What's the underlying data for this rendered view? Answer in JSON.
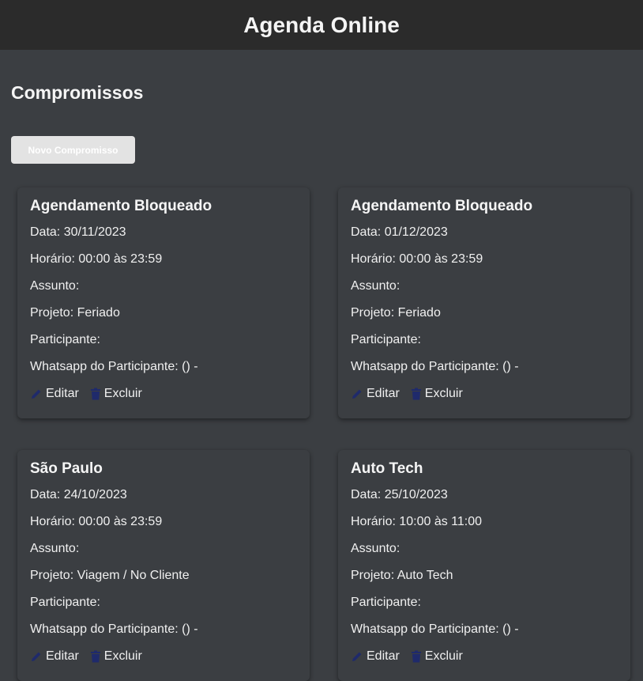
{
  "header": {
    "title": "Agenda Online"
  },
  "section": {
    "title": "Compromissos"
  },
  "toolbar": {
    "new_label": "Novo Compromisso"
  },
  "colors": {
    "icon": "#1f2a6b",
    "background": "#3b3e42",
    "topbar": "#2b2b2b"
  },
  "cards": [
    {
      "title": "Agendamento Bloqueado",
      "date": "Data: 30/11/2023",
      "time": "Horário: 00:00 às 23:59",
      "subject": "Assunto:",
      "project": "Projeto: Feriado",
      "participant": "Participante:",
      "whatsapp": "Whatsapp do Participante: () -",
      "edit_label": "Editar",
      "delete_label": "Excluir"
    },
    {
      "title": "Agendamento Bloqueado",
      "date": "Data: 01/12/2023",
      "time": "Horário: 00:00 às 23:59",
      "subject": "Assunto:",
      "project": "Projeto: Feriado",
      "participant": "Participante:",
      "whatsapp": "Whatsapp do Participante: () -",
      "edit_label": "Editar",
      "delete_label": "Excluir"
    },
    {
      "title": "São Paulo",
      "date": "Data: 24/10/2023",
      "time": "Horário: 00:00 às 23:59",
      "subject": "Assunto:",
      "project": "Projeto: Viagem / No Cliente",
      "participant": "Participante:",
      "whatsapp": "Whatsapp do Participante: () -",
      "edit_label": "Editar",
      "delete_label": "Excluir"
    },
    {
      "title": "Auto Tech",
      "date": "Data: 25/10/2023",
      "time": "Horário: 10:00 às 11:00",
      "subject": "Assunto:",
      "project": "Projeto: Auto Tech",
      "participant": "Participante:",
      "whatsapp": "Whatsapp do Participante: () -",
      "edit_label": "Editar",
      "delete_label": "Excluir"
    }
  ]
}
